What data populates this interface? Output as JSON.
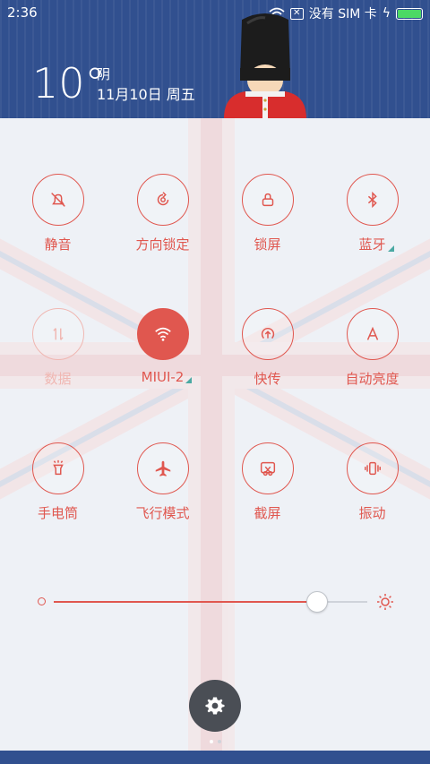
{
  "status_bar": {
    "time": "2:36",
    "carrier": "没有 SIM 卡",
    "icons": [
      "wifi-icon",
      "sim-error-icon",
      "charging-icon",
      "battery-icon"
    ],
    "battery_color": "#4cd964"
  },
  "weather": {
    "temperature": "10°",
    "condition": "阴",
    "date": "11月10日 周五"
  },
  "tiles": [
    {
      "label": "静音",
      "icon": "silent-bell-icon",
      "state": "off"
    },
    {
      "label": "方向锁定",
      "icon": "rotation-lock-icon",
      "state": "off"
    },
    {
      "label": "锁屏",
      "icon": "lock-icon",
      "state": "off"
    },
    {
      "label": "蓝牙",
      "icon": "bluetooth-icon",
      "state": "off",
      "has_more": true
    },
    {
      "label": "数据",
      "icon": "mobile-data-icon",
      "state": "disabled"
    },
    {
      "label": "MIUI-2",
      "icon": "wifi-icon",
      "state": "on",
      "has_more": true
    },
    {
      "label": "快传",
      "icon": "quick-transfer-icon",
      "state": "off"
    },
    {
      "label": "自动亮度",
      "icon": "auto-brightness-icon",
      "state": "off"
    },
    {
      "label": "手电筒",
      "icon": "flashlight-icon",
      "state": "off"
    },
    {
      "label": "飞行模式",
      "icon": "airplane-icon",
      "state": "off"
    },
    {
      "label": "截屏",
      "icon": "screenshot-icon",
      "state": "off"
    },
    {
      "label": "振动",
      "icon": "vibrate-icon",
      "state": "off"
    }
  ],
  "brightness": {
    "level": 0.84
  },
  "settings": {
    "icon": "gear-icon"
  },
  "colors": {
    "accent": "#e0574f",
    "header_blue": "#31508f",
    "panel": "#eef1f6"
  }
}
